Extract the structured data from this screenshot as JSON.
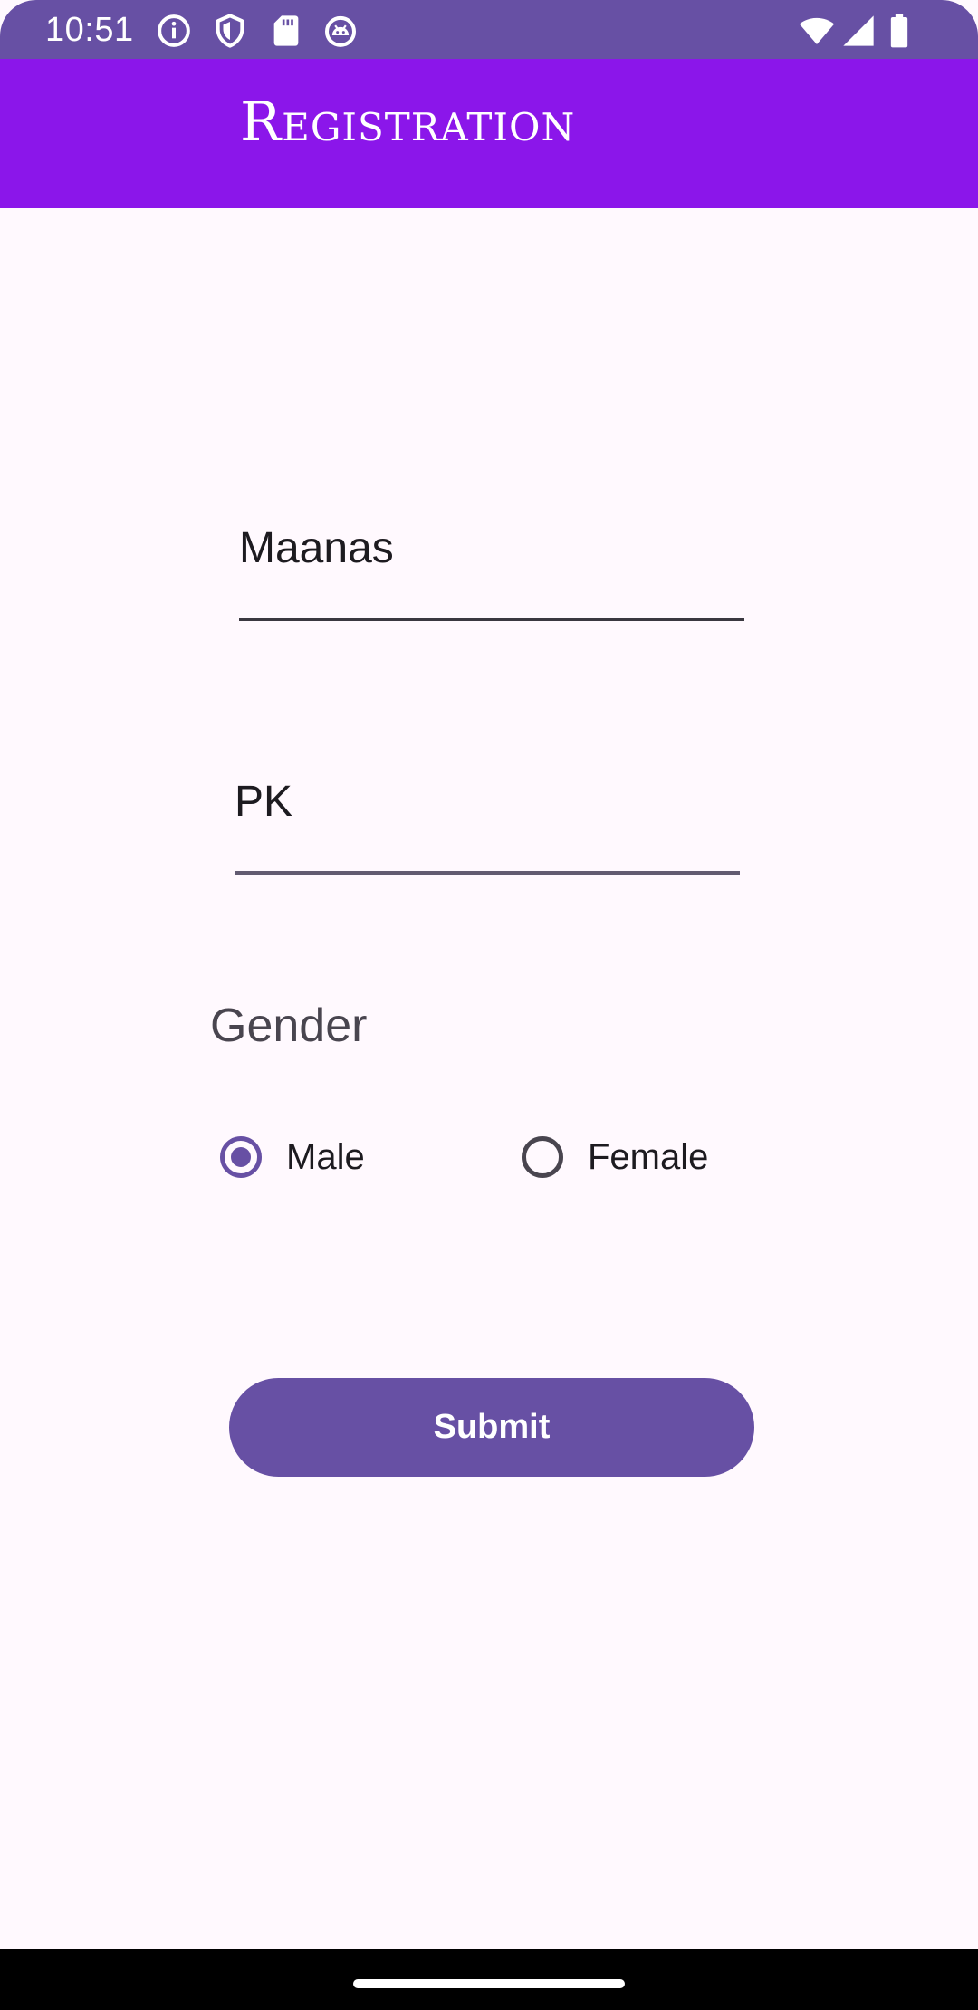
{
  "status_bar": {
    "time": "10:51",
    "left_icons": [
      "info-icon",
      "shield-icon",
      "sd-card-icon",
      "android-debug-icon"
    ],
    "right_icons": [
      "wifi-icon",
      "cellular-signal-icon",
      "battery-icon"
    ],
    "background": "#6750A4"
  },
  "app_bar": {
    "title": "Registration",
    "background": "#8B16EA"
  },
  "form": {
    "first_name_value": "Maanas",
    "last_name_value": "PK",
    "gender_label": "Gender",
    "gender_options": [
      {
        "label": "Male",
        "selected": true
      },
      {
        "label": "Female",
        "selected": false
      }
    ],
    "submit_label": "Submit"
  },
  "colors": {
    "primary": "#6750A4",
    "surface": "#FFF9FE",
    "on_surface": "#1D1B20"
  }
}
